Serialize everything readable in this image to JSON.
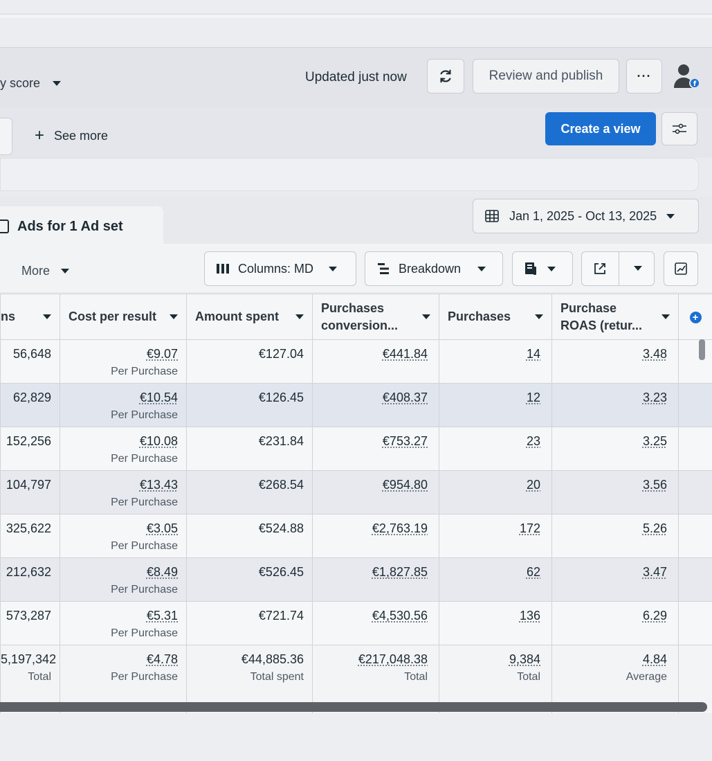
{
  "header": {
    "score_label": "y score",
    "updated_text": "Updated just now",
    "review_label": "Review and publish",
    "more_label": "···"
  },
  "filters": {
    "see_more_label": "See more",
    "create_view_label": "Create a view"
  },
  "panel": {
    "title": "Ads for 1 Ad set",
    "date_range": "Jan 1, 2025 - Oct 13, 2025"
  },
  "toolbar": {
    "more_label": "More",
    "columns_label": "Columns: MD",
    "breakdown_label": "Breakdown"
  },
  "table": {
    "headers": [
      "ns",
      "Cost per result",
      "Amount spent",
      "Purchases conversion...",
      "Purchases",
      "Purchase ROAS (retur..."
    ],
    "per_label": "Per Purchase",
    "rows": [
      {
        "c0": "56,648",
        "cost": "€9.07",
        "spent": "€127.04",
        "conv": "€441.84",
        "purchases": "14",
        "roas": "3.48"
      },
      {
        "c0": "62,829",
        "cost": "€10.54",
        "spent": "€126.45",
        "conv": "€408.37",
        "purchases": "12",
        "roas": "3.23"
      },
      {
        "c0": "152,256",
        "cost": "€10.08",
        "spent": "€231.84",
        "conv": "€753.27",
        "purchases": "23",
        "roas": "3.25"
      },
      {
        "c0": "104,797",
        "cost": "€13.43",
        "spent": "€268.54",
        "conv": "€954.80",
        "purchases": "20",
        "roas": "3.56"
      },
      {
        "c0": "325,622",
        "cost": "€3.05",
        "spent": "€524.88",
        "conv": "€2,763.19",
        "purchases": "172",
        "roas": "5.26"
      },
      {
        "c0": "212,632",
        "cost": "€8.49",
        "spent": "€526.45",
        "conv": "€1,827.85",
        "purchases": "62",
        "roas": "3.47"
      },
      {
        "c0": "573,287",
        "cost": "€5.31",
        "spent": "€721.74",
        "conv": "€4,530.56",
        "purchases": "136",
        "roas": "6.29"
      }
    ],
    "totals": {
      "c0": "5,197,342",
      "c0_sub": "Total",
      "cost": "€4.78",
      "cost_sub": "Per Purchase",
      "spent": "€44,885.36",
      "spent_sub": "Total spent",
      "conv": "€217,048.38",
      "conv_sub": "Total",
      "purchases": "9,384",
      "purchases_sub": "Total",
      "roas": "4.84",
      "roas_sub": "Average"
    }
  },
  "colors": {
    "primary": "#1b6fd1",
    "header_bg": "#e2e4ea",
    "row_alt": "#e7e9ee"
  }
}
